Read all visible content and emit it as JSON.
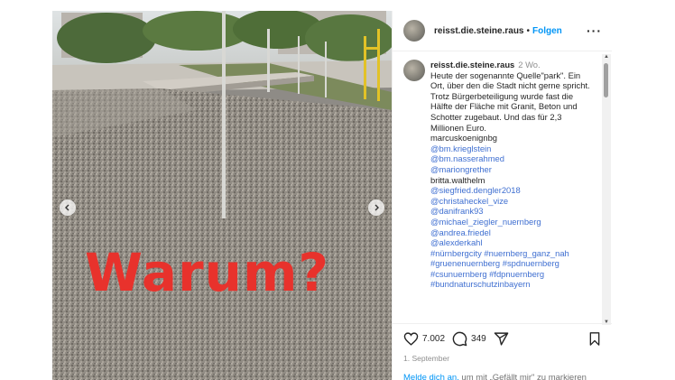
{
  "post": {
    "overlay_text": "Warum?",
    "header": {
      "username": "reisst.die.steine.raus",
      "separator": "•",
      "follow_label": "Folgen",
      "more_label": "···"
    },
    "caption": {
      "username": "reisst.die.steine.raus",
      "time": "2 Wo.",
      "text": "Heute der sogenannte Quelle\"park\". Ein Ort, über den die Stadt nicht gerne spricht. Trotz Bürgerbeteiligung wurde fast die Hälfte der Fläche mit Granit, Beton und Schotter zugebaut. Und das für 2,3 Millionen Euro.",
      "mentions": [
        {
          "text": "marcuskoenignbg",
          "link": false
        },
        {
          "text": "@bm.krieglstein",
          "link": true
        },
        {
          "text": "@bm.nasserahmed",
          "link": true
        },
        {
          "text": "@mariongrether",
          "link": true
        },
        {
          "text": "britta.walthelm",
          "link": false
        },
        {
          "text": "@siegfried.dengler2018",
          "link": true
        },
        {
          "text": "@christaheckel_vize",
          "link": true
        },
        {
          "text": "@danifrank93",
          "link": true
        },
        {
          "text": "@michael_ziegler_nuernberg",
          "link": true
        },
        {
          "text": "@andrea.friedel",
          "link": true
        },
        {
          "text": "@alexderkahl",
          "link": true
        },
        {
          "text": "#nürnbergcity #nuernberg_ganz_nah",
          "link": true
        },
        {
          "text": "#gruenenuernberg #spdnuernberg",
          "link": true
        },
        {
          "text": "#csunuernberg #fdpnuernberg",
          "link": true
        },
        {
          "text": "#bundnaturschutzinbayern",
          "link": true
        }
      ]
    },
    "likes": "7.002",
    "comments": "349",
    "date": "1. September",
    "login_link": "Melde dich an,",
    "login_text": " um mit „Gefällt mir\" zu markieren",
    "icons": {
      "heart": "heart-icon",
      "comment": "comment-icon",
      "share": "share-icon",
      "bookmark": "bookmark-icon",
      "prev": "chevron-left-icon",
      "next": "chevron-right-icon"
    },
    "colors": {
      "link": "#3f6fd1",
      "follow": "#0095f6",
      "overlay": "#e8322c"
    }
  }
}
